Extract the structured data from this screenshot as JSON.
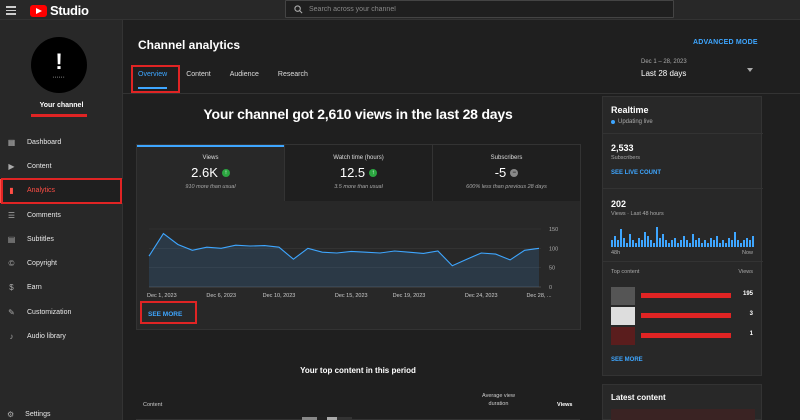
{
  "app": {
    "name": "Studio"
  },
  "search": {
    "placeholder": "Search across your channel"
  },
  "sidebar": {
    "channel_label": "Your channel",
    "items": [
      {
        "label": "Dashboard",
        "icon": "dashboard-icon"
      },
      {
        "label": "Content",
        "icon": "content-icon"
      },
      {
        "label": "Analytics",
        "icon": "analytics-icon",
        "active": true
      },
      {
        "label": "Comments",
        "icon": "comments-icon"
      },
      {
        "label": "Subtitles",
        "icon": "subtitles-icon"
      },
      {
        "label": "Copyright",
        "icon": "copyright-icon"
      },
      {
        "label": "Earn",
        "icon": "earn-icon"
      },
      {
        "label": "Customization",
        "icon": "customization-icon"
      },
      {
        "label": "Audio library",
        "icon": "audio-library-icon"
      }
    ],
    "settings_label": "Settings"
  },
  "main": {
    "title": "Channel analytics",
    "advanced_mode": "ADVANCED MODE",
    "tabs": [
      "Overview",
      "Content",
      "Audience",
      "Research"
    ],
    "period": {
      "range": "Dec 1 – 28, 2023",
      "label": "Last 28 days"
    },
    "headline": "Your channel got 2,610 views in the last 28 days",
    "stats": [
      {
        "label": "Views",
        "value": "2.6K",
        "trend": "up",
        "sub": "910 more than usual"
      },
      {
        "label": "Watch time (hours)",
        "value": "12.5",
        "trend": "up",
        "sub": "3.5 more than usual"
      },
      {
        "label": "Subscribers",
        "value": "-5",
        "trend": "neutral",
        "sub": "600% less than previous 28 days"
      }
    ],
    "see_more": "SEE MORE",
    "top_content": {
      "title": "Your top content in this period",
      "col_content": "Content",
      "col_avg_1": "Average view",
      "col_avg_2": "duration",
      "col_views": "Views"
    }
  },
  "chart_data": {
    "type": "area",
    "x": [
      "Dec 1, 2023",
      "Dec 2",
      "Dec 3",
      "Dec 4",
      "Dec 5",
      "Dec 6, 2023",
      "Dec 7",
      "Dec 8",
      "Dec 9",
      "Dec 10, 2023",
      "Dec 11",
      "Dec 12",
      "Dec 13",
      "Dec 14",
      "Dec 15, 2023",
      "Dec 16",
      "Dec 17",
      "Dec 18",
      "Dec 19, 2023",
      "Dec 20",
      "Dec 21",
      "Dec 22",
      "Dec 23",
      "Dec 24, 2023",
      "Dec 25",
      "Dec 26",
      "Dec 27",
      "Dec 28, ..."
    ],
    "y": [
      80,
      138,
      110,
      95,
      103,
      100,
      108,
      106,
      107,
      103,
      72,
      100,
      90,
      88,
      92,
      90,
      88,
      93,
      90,
      87,
      93,
      55,
      72,
      88,
      85,
      70,
      95,
      100
    ],
    "tick_labels": [
      "Dec 1, 2023",
      "Dec 6, 2023",
      "Dec 10, 2023",
      "Dec 15, 2023",
      "Dec 19, 2023",
      "Dec 24, 2023",
      "Dec 28, ..."
    ],
    "tick_index": [
      0,
      5,
      9,
      14,
      18,
      23,
      27
    ],
    "y_ticks": [
      "150",
      "100",
      "50",
      "0"
    ],
    "ylim": [
      0,
      150
    ],
    "grid": true,
    "color": "#3ea6ff"
  },
  "realtime": {
    "title": "Realtime",
    "updating": "Updating live",
    "subs_value": "2,533",
    "subs_label": "Subscribers",
    "see_live": "SEE LIVE COUNT",
    "views_value": "202",
    "views_label": "Views · Last 48 hours",
    "bars": [
      0.3,
      0.5,
      0.3,
      0.8,
      0.4,
      0.2,
      0.6,
      0.3,
      0.2,
      0.4,
      0.3,
      0.7,
      0.5,
      0.3,
      0.2,
      0.9,
      0.4,
      0.6,
      0.3,
      0.2,
      0.3,
      0.4,
      0.2,
      0.3,
      0.5,
      0.3,
      0.2,
      0.6,
      0.3,
      0.4,
      0.2,
      0.3,
      0.2,
      0.4,
      0.3,
      0.5,
      0.2,
      0.3,
      0.2,
      0.4,
      0.3,
      0.7,
      0.3,
      0.2,
      0.3,
      0.4,
      0.3,
      0.5
    ],
    "axis_left": "48h",
    "axis_right": "Now",
    "top_label": "Top content",
    "views_col": "Views",
    "rows": [
      "195",
      "3",
      "1"
    ],
    "see_more": "SEE MORE"
  },
  "latest": {
    "title": "Latest content"
  }
}
